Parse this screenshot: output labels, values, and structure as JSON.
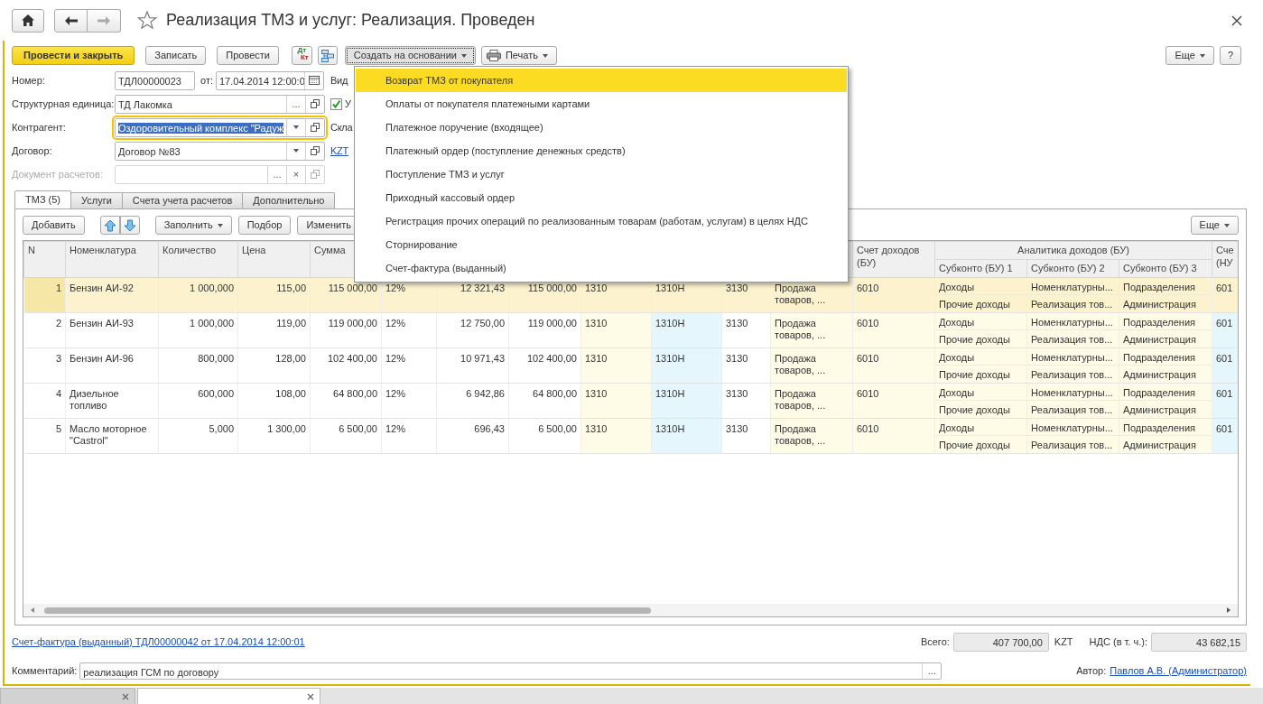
{
  "window": {
    "title": "Реализация ТМЗ и услуг: Реализация. Проведен",
    "favorite": false
  },
  "toolbar": {
    "buttons": [
      {
        "label": "Провести и закрыть",
        "kind": "primary"
      },
      {
        "label": "Записать",
        "kind": "plain"
      },
      {
        "label": "Провести",
        "kind": "plain"
      }
    ],
    "dt_kt": {
      "top": "Дт",
      "bottom": "Кт"
    },
    "create_based_on": {
      "label": "Создать на основании",
      "expanded": true,
      "items": [
        {
          "label": "Возврат ТМЗ от покупателя",
          "selected": true
        },
        {
          "label": "Оплаты от покупателя платежными картами",
          "selected": false
        },
        {
          "label": "Платежное поручение (входящее)",
          "selected": false
        },
        {
          "label": "Платежный ордер (поступление денежных средств)",
          "selected": false
        },
        {
          "label": "Поступление ТМЗ и услуг",
          "selected": false
        },
        {
          "label": "Приходный кассовый ордер",
          "selected": false
        },
        {
          "label": "Регистрация прочих операций по реализованным товарам (работам, услугам) в целях НДС",
          "selected": false
        },
        {
          "label": "Сторнирование",
          "selected": false
        },
        {
          "label": "Счет-фактура (выданный)",
          "selected": false
        }
      ]
    },
    "print": {
      "label": "Печать"
    },
    "more": "Еще",
    "help": "?"
  },
  "form": {
    "number": {
      "label": "Номер:",
      "value": "ТДЛ00000023"
    },
    "date": {
      "label": "от:",
      "value": "17.04.2014 12:00:0"
    },
    "fields": [
      {
        "label": "Структурная единица:",
        "value": "ТД Лакомка",
        "kind": "choice",
        "choose": "...",
        "focused": false,
        "disabled": false
      },
      {
        "label": "Контрагент:",
        "value": "Оздоровительный комплекс \"Радуж",
        "kind": "dropdown",
        "focused": true,
        "disabled": false
      },
      {
        "label": "Договор:",
        "value": "Договор №83",
        "kind": "dropdown",
        "focused": false,
        "disabled": false
      },
      {
        "label": "Документ расчетов:",
        "kind": "clearable",
        "choose": "...",
        "clear": "×",
        "focused": false,
        "disabled": true
      }
    ],
    "side": [
      {
        "kind": "label",
        "text": "Вид"
      },
      {
        "kind": "checkbox",
        "text": "У",
        "checked": true
      },
      {
        "kind": "label",
        "text": "Скла"
      },
      {
        "kind": "link",
        "text": "KZT"
      }
    ]
  },
  "tabs": [
    {
      "label": "ТМЗ (5)",
      "selected": true
    },
    {
      "label": "Услуги",
      "selected": false
    },
    {
      "label": "Счета учета расчетов",
      "selected": false
    },
    {
      "label": "Дополнительно",
      "selected": false
    }
  ],
  "table_toolbar": {
    "add": "Добавить",
    "fill": "Заполнить",
    "pick": "Подбор",
    "edit": "Изменить",
    "more": "Еще"
  },
  "table": {
    "columns": [
      {
        "label": "N"
      },
      {
        "label": "Номенклатура"
      },
      {
        "label": "Количество"
      },
      {
        "label": "Цена"
      },
      {
        "label": "Сумма"
      },
      {},
      {},
      {},
      {},
      {},
      {},
      {},
      {
        "label": "Счет доходов (БУ)"
      },
      {
        "label": "Аналитика доходов (БУ)",
        "colspan": 3,
        "children": [
          {
            "label": "Субконто (БУ) 1"
          },
          {
            "label": "Субконто (БУ) 2"
          },
          {
            "label": "Субконто (БУ) 3"
          }
        ]
      },
      {
        "label": "Сче (НУ"
      }
    ],
    "rows": [
      {
        "selected": true,
        "cells": [
          "1",
          "Бензин АИ-92",
          "1 000,000",
          "115,00",
          "115 000,00",
          "12%",
          "12 321,43",
          "115 000,00",
          "1310",
          "1310Н",
          "3130",
          "Продажа товаров, ...",
          "6010",
          [
            "Доходы",
            "Прочие доходы"
          ],
          [
            "Номенклатурны...",
            "Реализация тов..."
          ],
          [
            "Подразделения",
            "Администрация"
          ],
          "601"
        ]
      },
      {
        "selected": false,
        "cells": [
          "2",
          "Бензин АИ-93",
          "1 000,000",
          "119,00",
          "119 000,00",
          "12%",
          "12 750,00",
          "119 000,00",
          "1310",
          "1310Н",
          "3130",
          "Продажа товаров, ...",
          "6010",
          [
            "Доходы",
            "Прочие доходы"
          ],
          [
            "Номенклатурны...",
            "Реализация тов..."
          ],
          [
            "Подразделения",
            "Администрация"
          ],
          "601"
        ]
      },
      {
        "selected": false,
        "cells": [
          "3",
          "Бензин АИ-96",
          "800,000",
          "128,00",
          "102 400,00",
          "12%",
          "10 971,43",
          "102 400,00",
          "1310",
          "1310Н",
          "3130",
          "Продажа товаров, ...",
          "6010",
          [
            "Доходы",
            "Прочие доходы"
          ],
          [
            "Номенклатурны...",
            "Реализация тов..."
          ],
          [
            "Подразделения",
            "Администрация"
          ],
          "601"
        ]
      },
      {
        "selected": false,
        "cells": [
          "4",
          "Дизельное топливо",
          "600,000",
          "108,00",
          "64 800,00",
          "12%",
          "6 942,86",
          "64 800,00",
          "1310",
          "1310Н",
          "3130",
          "Продажа товаров, ...",
          "6010",
          [
            "Доходы",
            "Прочие доходы"
          ],
          [
            "Номенклатурны...",
            "Реализация тов..."
          ],
          [
            "Подразделения",
            "Администрация"
          ],
          "601"
        ]
      },
      {
        "selected": false,
        "cells": [
          "5",
          "Масло моторное \"Castrol\"",
          "5,000",
          "1 300,00",
          "6 500,00",
          "12%",
          "696,43",
          "6 500,00",
          "1310",
          "1310Н",
          "3130",
          "Продажа товаров, ...",
          "6010",
          [
            "Доходы",
            "Прочие доходы"
          ],
          [
            "Номенклатурны...",
            "Реализация тов..."
          ],
          [
            "Подразделения",
            "Администрация"
          ],
          "601"
        ]
      }
    ]
  },
  "footer": {
    "invoice_link": "Счет-фактура (выданный) ТДЛ00000042 от 17.04.2014 12:00:01",
    "total": {
      "label": "Всего:",
      "value": "407 700,00",
      "currency": "KZT"
    },
    "vat": {
      "label": "НДС (в т. ч.):",
      "value": "43 682,15"
    },
    "comment": {
      "label": "Комментарий:",
      "value": "реализация ГСМ по договору",
      "choose": "..."
    },
    "author": {
      "label": "Автор:",
      "link": "Павлов А.В. (Администратор)"
    }
  },
  "taskbar": {
    "tabs": [
      {
        "selected": false
      },
      {
        "selected": true
      }
    ]
  }
}
